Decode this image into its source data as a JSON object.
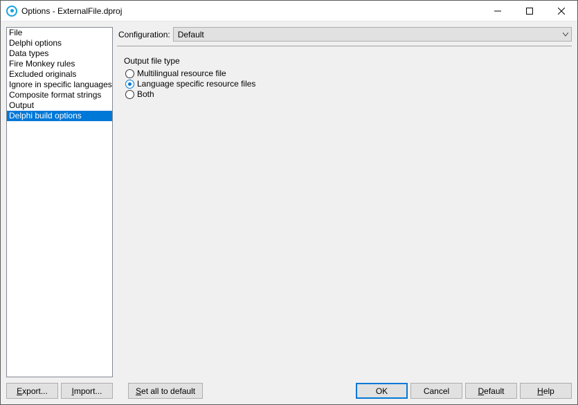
{
  "titlebar": {
    "title": "Options - ExternalFile.dproj"
  },
  "sidebar": {
    "items": [
      {
        "label": "File"
      },
      {
        "label": "Delphi options"
      },
      {
        "label": "Data types"
      },
      {
        "label": "Fire Monkey rules"
      },
      {
        "label": "Excluded originals"
      },
      {
        "label": "Ignore in specific languages"
      },
      {
        "label": "Composite format strings"
      },
      {
        "label": "Output"
      },
      {
        "label": "Delphi build options"
      }
    ]
  },
  "config": {
    "label": "Configuration:",
    "value": "Default"
  },
  "group": {
    "label": "Output file type",
    "options": [
      {
        "label": "Multilingual resource file"
      },
      {
        "label": "Language specific resource files"
      },
      {
        "label": "Both"
      }
    ]
  },
  "footer": {
    "export_pre": "",
    "export_u": "E",
    "export_post": "xport...",
    "import_pre": "",
    "import_u": "I",
    "import_post": "mport...",
    "setall_pre": "",
    "setall_u": "S",
    "setall_post": "et all to default",
    "ok": "OK",
    "cancel": "Cancel",
    "default_pre": "",
    "default_u": "D",
    "default_post": "efault",
    "help_pre": "",
    "help_u": "H",
    "help_post": "elp"
  }
}
